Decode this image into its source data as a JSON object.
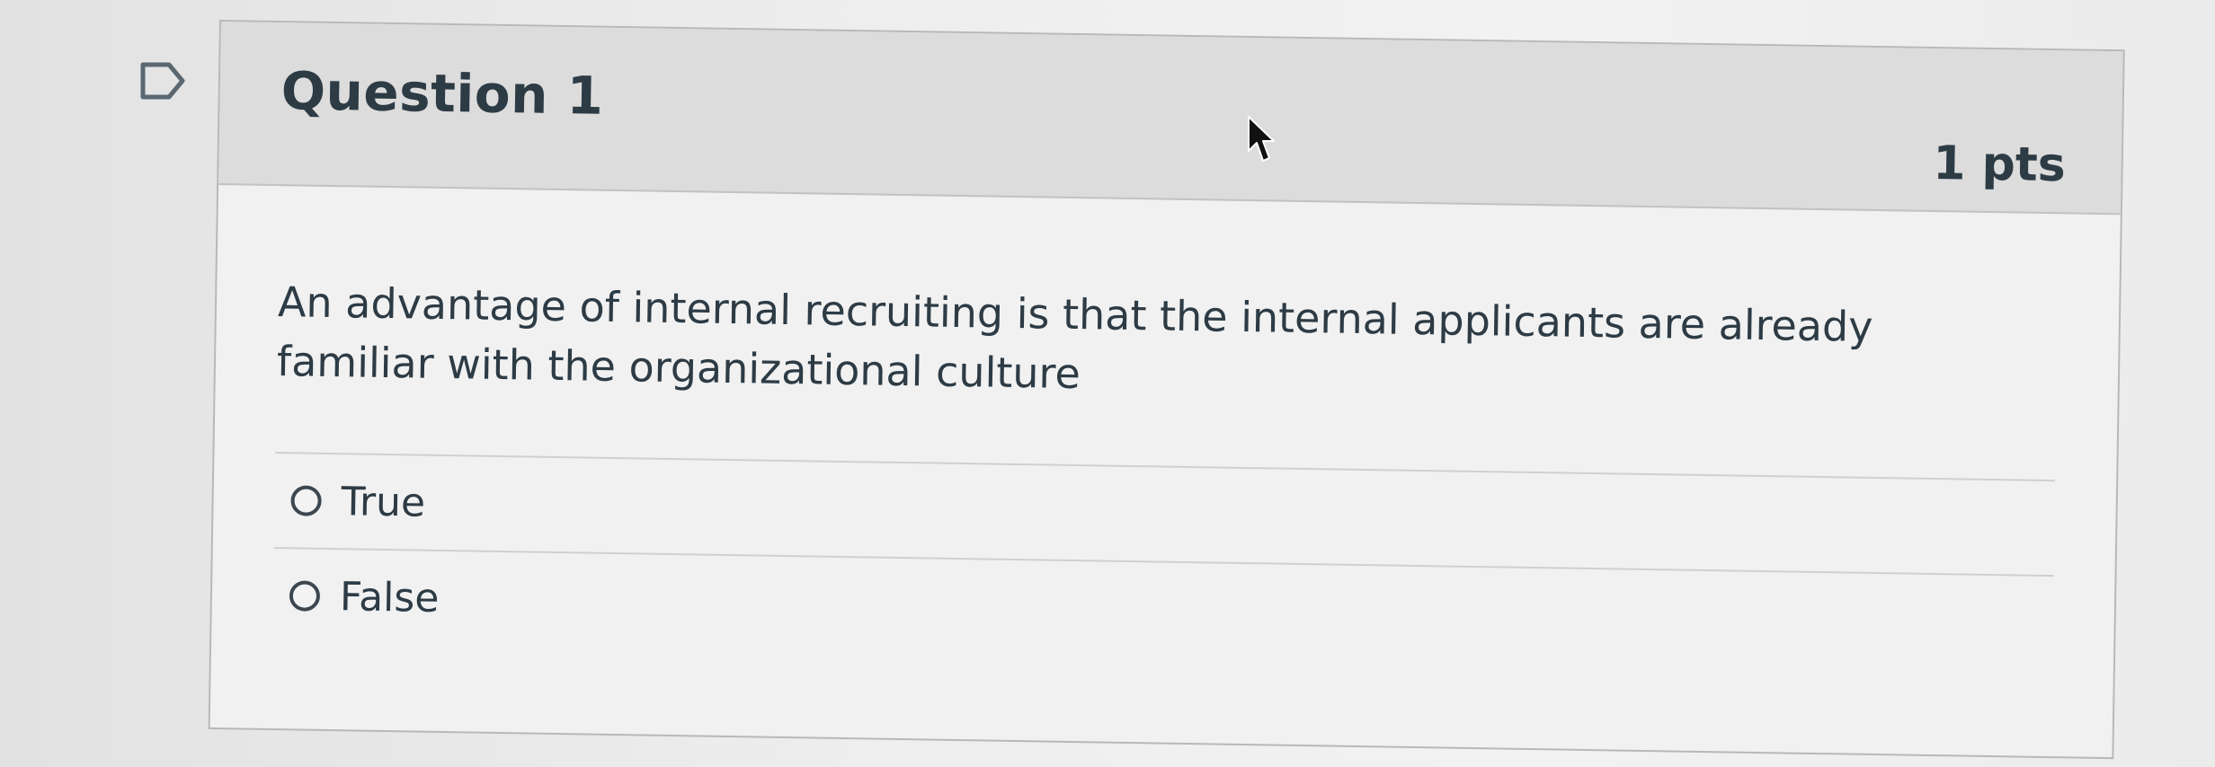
{
  "question": {
    "title": "Question 1",
    "points": "1 pts",
    "text": "An advantage of internal recruiting is that the internal applicants are already familiar with the organizational culture"
  },
  "answers": [
    {
      "label": "True",
      "selected": false
    },
    {
      "label": "False",
      "selected": false
    }
  ],
  "icons": {
    "flag": "flag-outline-icon",
    "cursor": "mouse-pointer-icon",
    "radio": "radio-unselected-icon"
  },
  "colors": {
    "text": "#2d3b45",
    "header_background": "#dcdcdc",
    "body_background": "#f1f1f1",
    "border": "#b8b8b8"
  }
}
